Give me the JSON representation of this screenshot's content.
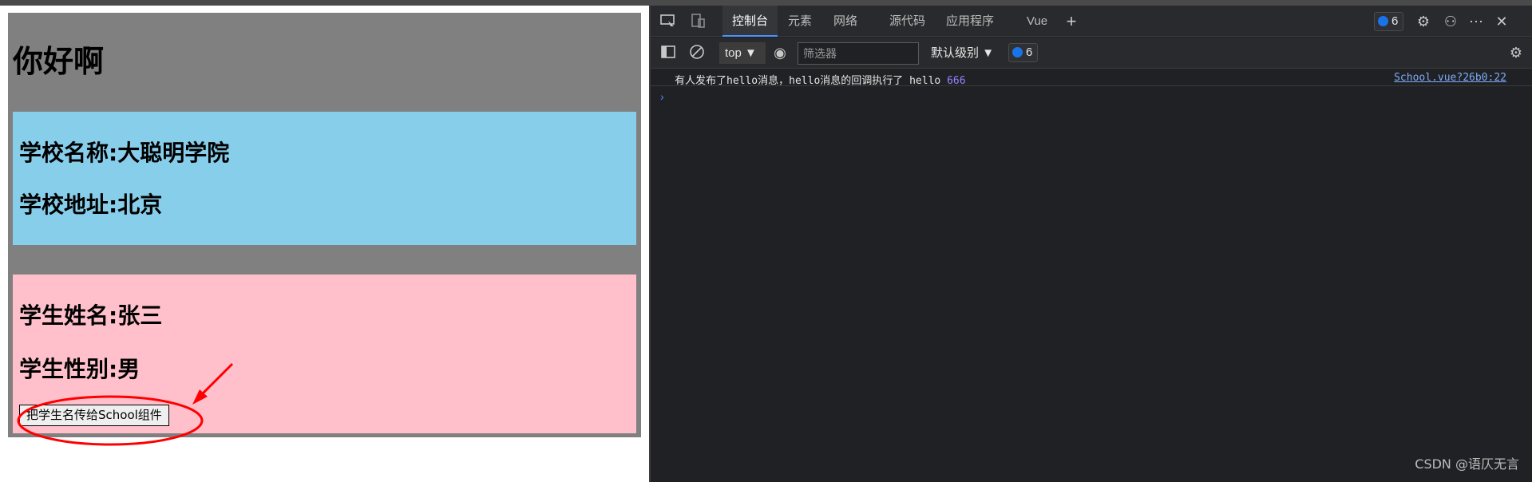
{
  "app": {
    "title": "你好啊",
    "school": {
      "name_line": "学校名称:大聪明学院",
      "address_line": "学校地址:北京"
    },
    "student": {
      "name_line": "学生姓名:张三",
      "gender_line": "学生性别:男",
      "button_label": "把学生名传给School组件"
    }
  },
  "devtools": {
    "tabs": [
      "控制台",
      "元素",
      "网络",
      "源代码",
      "应用程序",
      "Vue"
    ],
    "issues_count": "6",
    "toolbar": {
      "context": "top",
      "filter_placeholder": "筛选器",
      "level": "默认级别",
      "message_count": "6"
    },
    "console": {
      "log_message": "有人发布了hello消息，hello消息的回调执行了 hello",
      "log_value": "666",
      "log_source": "School.vue?26b0:22"
    }
  },
  "watermark": "CSDN @语仄无言",
  "colors": {
    "school_bg": "#87ceeb",
    "student_bg": "#ffc0cb",
    "app_bg": "#808080",
    "annotation": "#ff0000"
  }
}
